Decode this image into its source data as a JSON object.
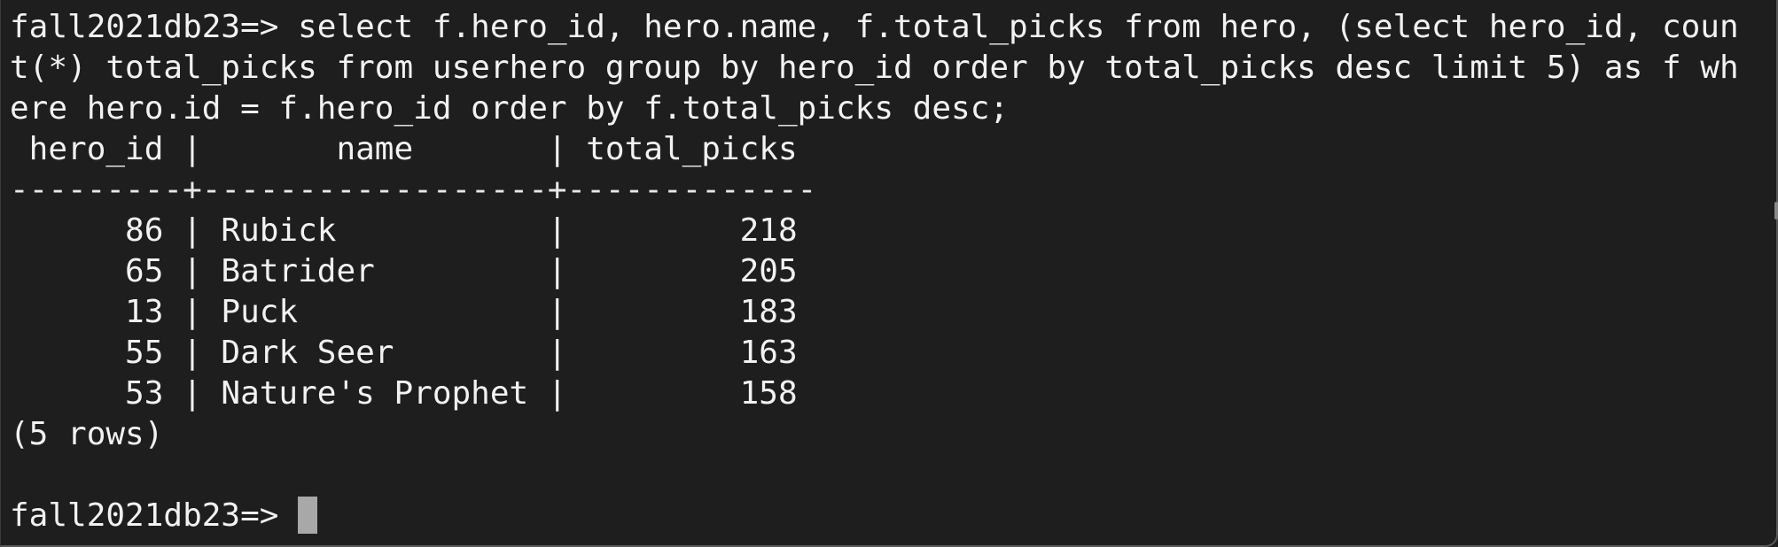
{
  "terminal": {
    "prompt": "fall2021db23=> ",
    "query_lines": [
      "select f.hero_id, hero.name, f.total_picks from hero, (select hero_id, coun",
      "t(*) total_picks from userhero group by hero_id order by total_picks desc limit 5) as f wh",
      "ere hero.id = f.hero_id order by f.total_picks desc;"
    ],
    "table": {
      "header": " hero_id |       name       | total_picks ",
      "separator": "---------+------------------+-------------",
      "rows": [
        "      86 | Rubick           |         218",
        "      65 | Batrider         |         205",
        "      13 | Puck             |         183",
        "      55 | Dark Seer        |         163",
        "      53 | Nature's Prophet |         158"
      ]
    },
    "row_count": "(5 rows)",
    "final_prompt": "fall2021db23=> "
  }
}
